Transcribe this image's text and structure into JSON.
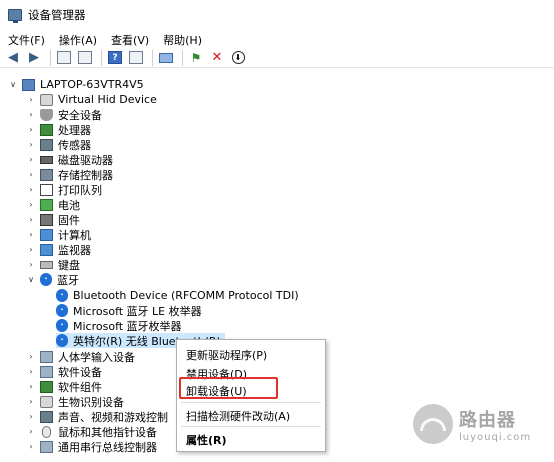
{
  "window": {
    "title": "设备管理器"
  },
  "menu": [
    "文件(F)",
    "操作(A)",
    "查看(V)",
    "帮助(H)"
  ],
  "tree": {
    "root": "LAPTOP-63VTR4V5",
    "categories": [
      "Virtual Hid Device",
      "安全设备",
      "处理器",
      "传感器",
      "磁盘驱动器",
      "存储控制器",
      "打印队列",
      "电池",
      "固件",
      "计算机",
      "监视器",
      "键盘",
      "蓝牙"
    ],
    "bluetooth_children": [
      "Bluetooth Device (RFCOMM Protocol TDI)",
      "Microsoft 蓝牙 LE 枚举器",
      "Microsoft 蓝牙枚举器",
      "英特尔(R) 无线 Bluetooth(R)"
    ],
    "after_categories": [
      "人体学输入设备",
      "软件设备",
      "软件组件",
      "生物识别设备",
      "声音、视频和游戏控制",
      "鼠标和其他指针设备",
      "通用串行总线控制器"
    ]
  },
  "context_menu": {
    "items": [
      "更新驱动程序(P)",
      "禁用设备(D)",
      "卸载设备(U)",
      "扫描检测硬件改动(A)",
      "属性(R)"
    ],
    "highlight_color": "#e0312b"
  },
  "watermark": {
    "cn": "路由器",
    "en": "luyouqi.com"
  }
}
